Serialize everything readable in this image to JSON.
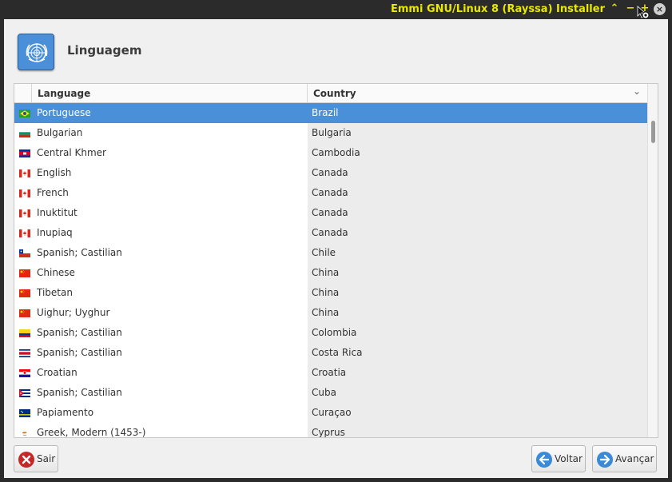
{
  "window": {
    "title": "Emmi GNU/Linux 8 (Rayssa) Installer",
    "controls": {
      "up": "⌃",
      "minimize": "−",
      "maximize": "+",
      "close": "×"
    }
  },
  "header": {
    "title": "Linguagem",
    "logo_icon": "un-emblem-icon"
  },
  "table": {
    "columns": [
      "Language",
      "Country"
    ],
    "sort_indicator_icon": "chevron-down-icon",
    "selected_index": 0,
    "rows": [
      {
        "language": "Portuguese",
        "country": "Brazil",
        "flag": "brazil"
      },
      {
        "language": "Bulgarian",
        "country": "Bulgaria",
        "flag": "bulgaria"
      },
      {
        "language": "Central Khmer",
        "country": "Cambodia",
        "flag": "cambodia"
      },
      {
        "language": "English",
        "country": "Canada",
        "flag": "canada"
      },
      {
        "language": "French",
        "country": "Canada",
        "flag": "canada"
      },
      {
        "language": "Inuktitut",
        "country": "Canada",
        "flag": "canada"
      },
      {
        "language": "Inupiaq",
        "country": "Canada",
        "flag": "canada"
      },
      {
        "language": "Spanish; Castilian",
        "country": "Chile",
        "flag": "chile"
      },
      {
        "language": "Chinese",
        "country": "China",
        "flag": "china"
      },
      {
        "language": "Tibetan",
        "country": "China",
        "flag": "china"
      },
      {
        "language": "Uighur; Uyghur",
        "country": "China",
        "flag": "china"
      },
      {
        "language": "Spanish; Castilian",
        "country": "Colombia",
        "flag": "colombia"
      },
      {
        "language": "Spanish; Castilian",
        "country": "Costa Rica",
        "flag": "costa-rica"
      },
      {
        "language": "Croatian",
        "country": "Croatia",
        "flag": "croatia"
      },
      {
        "language": "Spanish; Castilian",
        "country": "Cuba",
        "flag": "cuba"
      },
      {
        "language": "Papiamento",
        "country": "Curaçao",
        "flag": "curacao"
      },
      {
        "language": "Greek, Modern (1453-)",
        "country": "Cyprus",
        "flag": "cyprus"
      }
    ]
  },
  "footer": {
    "quit_label": "Sair",
    "back_label": "Voltar",
    "next_label": "Avançar"
  },
  "colors": {
    "titlebar_bg": "#2b2b2b",
    "titlebar_text": "#e8e800",
    "selection": "#4a90d9"
  }
}
